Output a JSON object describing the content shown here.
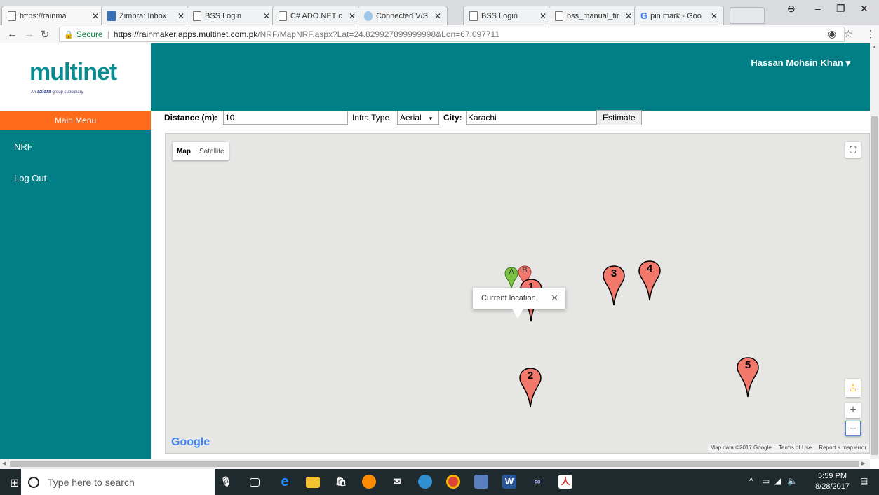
{
  "browser": {
    "tabs": [
      {
        "label": "https://rainma",
        "icon": "page-icon",
        "active": true
      },
      {
        "label": "Zimbra: Inbox",
        "icon": "zimbra-icon"
      },
      {
        "label": "BSS Login",
        "icon": "page-icon"
      },
      {
        "label": "C# ADO.NET c",
        "icon": "page-icon"
      },
      {
        "label": "Connected V/S",
        "icon": "spinner-icon"
      },
      {
        "label": "BSS Login",
        "icon": "page-icon"
      },
      {
        "label": "bss_manual_fir",
        "icon": "page-icon"
      },
      {
        "label": "pin mark - Goo",
        "icon": "google-icon"
      }
    ],
    "address": {
      "secure_label": "Secure",
      "host": "https://rainmaker.apps.multinet.com.pk",
      "path": "/NRF/MapNRF.aspx?Lat=24.829927899999998&Lon=67.097711"
    }
  },
  "header": {
    "logo_text": "multinet",
    "logo_sub_prefix": "An",
    "logo_sub_brand": "axiata",
    "logo_sub_suffix": "group subsidiary",
    "user_name": "Hassan Mohsin Khan",
    "user_caret": "▾"
  },
  "sidebar": {
    "main_menu_label": "Main Menu",
    "items": [
      {
        "label": "NRF"
      },
      {
        "label": "Log Out"
      }
    ]
  },
  "form": {
    "distance_label": "Distance (m):",
    "distance_value": "10",
    "infra_label": "Infra Type",
    "infra_value": "Aerial",
    "city_label": "City:",
    "city_value": "Karachi",
    "estimate_label": "Estimate"
  },
  "map": {
    "type_map": "Map",
    "type_satellite": "Satellite",
    "info_text": "Current location.",
    "google_logo": "Google",
    "attribution": "Map data ©2017 Google",
    "terms": "Terms of Use",
    "report": "Report a map error",
    "markers": [
      {
        "label": "A",
        "color": "#7cc242"
      },
      {
        "label": "B",
        "color": "#f2786c"
      },
      {
        "label": "1",
        "color": "#f2786c"
      },
      {
        "label": "2",
        "color": "#f2786c"
      },
      {
        "label": "3",
        "color": "#f2786c"
      },
      {
        "label": "4",
        "color": "#f2786c"
      },
      {
        "label": "5",
        "color": "#f2786c"
      }
    ]
  },
  "taskbar": {
    "search_placeholder": "Type here to search",
    "time": "5:59 PM",
    "date": "8/28/2017"
  },
  "colors": {
    "teal": "#017f86",
    "orange": "#ff6a1a"
  }
}
